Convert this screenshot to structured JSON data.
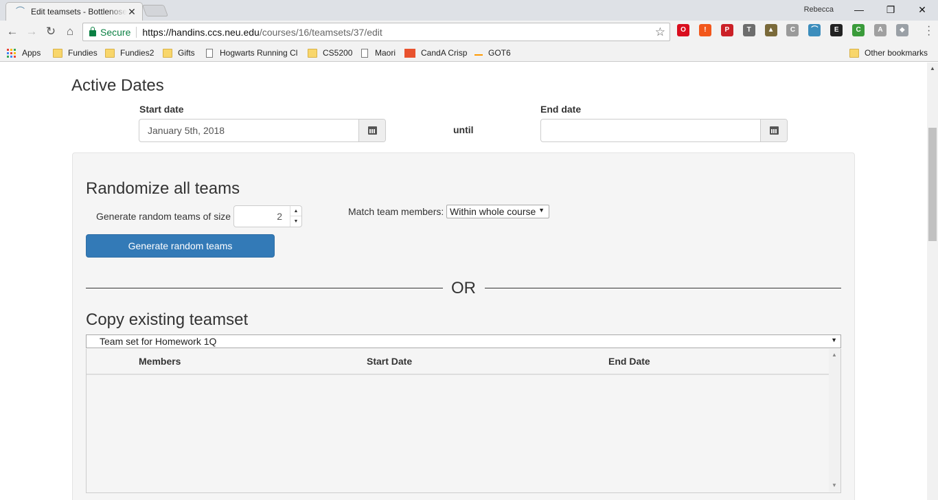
{
  "browser": {
    "tab_title": "Edit teamsets - Bottlenose",
    "profile_name": "Rebecca",
    "secure_label": "Secure",
    "url_scheme_host": "https://handins.ccs.neu.edu",
    "url_path": "/courses/16/teamsets/37/edit",
    "extensions": [
      {
        "name": "opera-icon",
        "color": "#d90e1e",
        "glyph": "O"
      },
      {
        "name": "alert-icon",
        "color": "#f2571b",
        "glyph": "!"
      },
      {
        "name": "pinterest-icon",
        "color": "#cb2027",
        "glyph": "P"
      },
      {
        "name": "t-icon",
        "color": "#6d6d6d",
        "glyph": "T"
      },
      {
        "name": "plant-icon",
        "color": "#7a6a3a",
        "glyph": "▲"
      },
      {
        "name": "css-icon",
        "color": "#9a9a9a",
        "glyph": "C"
      },
      {
        "name": "rainbow-icon",
        "color": "#3c8dbc",
        "glyph": "⌒"
      },
      {
        "name": "e-icon",
        "color": "#222222",
        "glyph": "E"
      },
      {
        "name": "cors-icon",
        "color": "#3a9b3a",
        "glyph": "C"
      },
      {
        "name": "pdf-icon",
        "color": "#a0a0a0",
        "glyph": "A"
      },
      {
        "name": "dropbox-icon",
        "color": "#9aa0a6",
        "glyph": "◆"
      }
    ],
    "bookmarks": [
      {
        "label": "Apps",
        "type": "apps"
      },
      {
        "label": "Fundies",
        "type": "folder"
      },
      {
        "label": "Fundies2",
        "type": "folder"
      },
      {
        "label": "Gifts",
        "type": "folder"
      },
      {
        "label": "Hogwarts Running Cl",
        "type": "page"
      },
      {
        "label": "CS5200",
        "type": "folder"
      },
      {
        "label": "Maori",
        "type": "page"
      },
      {
        "label": "CandA Crisp",
        "type": "mw"
      },
      {
        "label": "GOT6",
        "type": "amazon"
      }
    ],
    "other_bookmarks": "Other bookmarks"
  },
  "active_dates": {
    "heading": "Active Dates",
    "start_label": "Start date",
    "start_value": "January 5th, 2018",
    "until": "until",
    "end_label": "End date",
    "end_value": ""
  },
  "randomize": {
    "heading": "Randomize all teams",
    "size_label": "Generate random teams of size",
    "size_value": "2",
    "match_label": "Match team members:",
    "match_value": "Within whole course",
    "button": "Generate random teams"
  },
  "separator": "OR",
  "copy": {
    "heading": "Copy existing teamset",
    "selected": "Team set for Homework 1Q",
    "columns": [
      "Members",
      "Start Date",
      "End Date"
    ]
  }
}
